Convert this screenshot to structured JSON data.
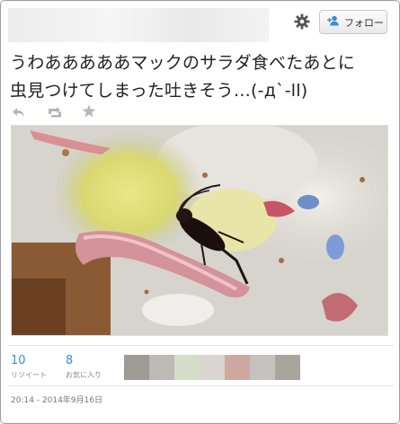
{
  "header": {
    "follow_label": "フォロー"
  },
  "tweet": {
    "line1": "うわあああああマックのサラダ食べたあとに",
    "line2": "虫見つけてしまった吐きそう…(-д`-ll)"
  },
  "stats": {
    "retweets": "10",
    "retweets_label": "リツイート",
    "favorites": "8",
    "favorites_label": "お気に入り"
  },
  "timestamp": "20:14 - 2014年9月16日",
  "colors": {
    "accent": "#3a8ed3",
    "follow_icon": "#3a8ed3",
    "action_icon": "#b6b6b6"
  },
  "icons": {
    "settings": "gear-icon",
    "follow": "add-person-icon",
    "reply": "reply-icon",
    "retweet": "retweet-icon",
    "favorite": "star-icon"
  }
}
